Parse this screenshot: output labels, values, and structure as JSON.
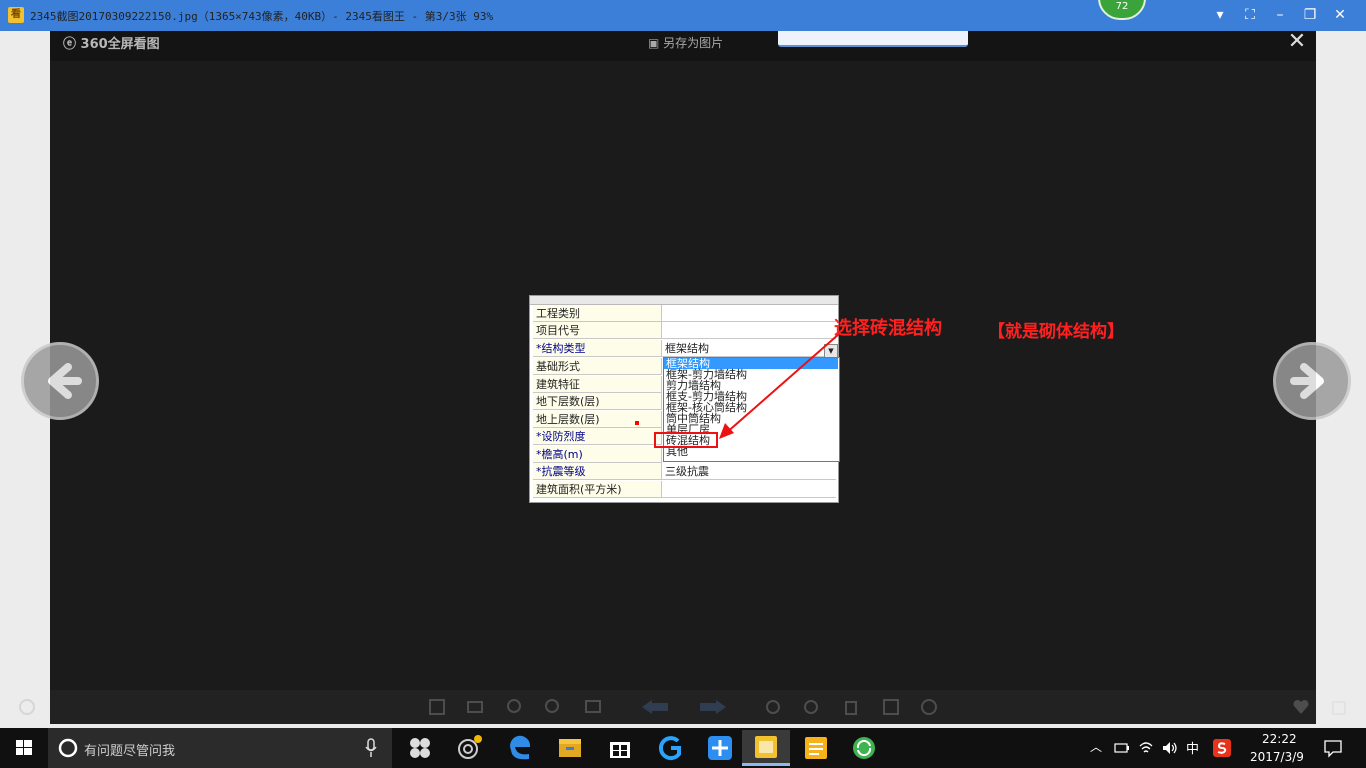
{
  "window": {
    "title": "2345截图20170309222150.jpg（1365×743像素，40KB）- 2345看图王 - 第3/3张 93%",
    "score_badge": "72",
    "controls": {
      "menu": "▾",
      "fullscreen": "⛶",
      "minimize": "–",
      "restore": "❐",
      "close": "✕"
    }
  },
  "viewer": {
    "brand": "360全屏看图",
    "save_as": "另存为图片",
    "close": "✕"
  },
  "form": {
    "rows": [
      {
        "label": "工程类别",
        "required": false,
        "value": ""
      },
      {
        "label": "项目代号",
        "required": false,
        "value": ""
      },
      {
        "label": "*结构类型",
        "required": true,
        "value": "框架结构"
      },
      {
        "label": "基础形式",
        "required": false,
        "value": ""
      },
      {
        "label": "建筑特征",
        "required": false,
        "value": ""
      },
      {
        "label": "地下层数(层)",
        "required": false,
        "value": ""
      },
      {
        "label": "地上层数(层)",
        "required": false,
        "value": ""
      },
      {
        "label": "*设防烈度",
        "required": true,
        "value": ""
      },
      {
        "label": "*檐高(m)",
        "required": true,
        "value": ""
      },
      {
        "label": "*抗震等级",
        "required": true,
        "value": "三级抗震"
      },
      {
        "label": "建筑面积(平方米)",
        "required": false,
        "value": ""
      }
    ],
    "dropdown": {
      "options": [
        "框架结构",
        "框架-剪力墙结构",
        "剪力墙结构",
        "框支-剪力墙结构",
        "框架-核心筒结构",
        "筒中筒结构",
        "单层厂房",
        "砖混结构",
        "其他"
      ],
      "selected": "框架结构",
      "highlighted": "砖混结构"
    }
  },
  "annotation": {
    "main": "选择砖混结构",
    "sub": "【就是砌体结构】",
    "color": "#ff2020"
  },
  "taskbar": {
    "search_placeholder": "有问题尽管问我",
    "ime_label": "中",
    "time": "22:22",
    "date": "2017/3/9"
  }
}
